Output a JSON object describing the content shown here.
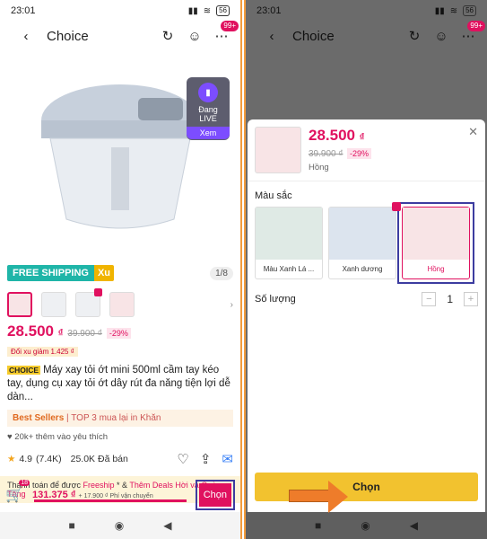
{
  "status": {
    "time": "23:01",
    "battery": "56"
  },
  "left": {
    "title": "Choice",
    "cart_badge": "99+",
    "live": {
      "label1": "Đang",
      "label2": "LIVE",
      "action": "Xem"
    },
    "free_shipping": "FREE SHIPPING",
    "xu": "Xu",
    "pager": "1/8",
    "price": "28.500",
    "currency": "₫",
    "old_price": "39.900 ₫",
    "discount": "-29%",
    "xu_reduce": "Đổi xu giảm 1.425 ₫",
    "choice_tag": "CHOICE",
    "product_title": "Máy xay tỏi ớt mini 500ml cầm tay kéo tay, dụng cụ xay tỏi ớt dây rút đa năng tiện lợi dễ dàn...",
    "best_sellers": "Best Sellers",
    "best_detail": "TOP 3 mua lại in Khăn",
    "favorites": "20k+ thêm vào yêu thích",
    "rating": "4.9",
    "rating_count": "(7.4K)",
    "sold": "25.0K Đã bán",
    "promo_prefix": "Thanh toán để được",
    "promo_freeship": "Freeship",
    "promo_mid": "* &",
    "promo_deals": "Thêm Deals Hời và Quà Tặng",
    "cart_count": "18",
    "total": "131.375 ₫",
    "total_sub": "+ 17.900 ₫ Phí vận chuyển",
    "choose": "Chọn"
  },
  "right": {
    "title": "Choice",
    "cart_badge": "99+",
    "price": "28.500",
    "currency": "₫",
    "old_price": "39.900 ₫",
    "discount": "-29%",
    "selected_color": "Hồng",
    "color_label": "Màu sắc",
    "variants": [
      "Màu Xanh Lá ...",
      "Xanh dương",
      "Hồng"
    ],
    "qty_label": "Số lượng",
    "qty": "1",
    "choose": "Chọn"
  }
}
